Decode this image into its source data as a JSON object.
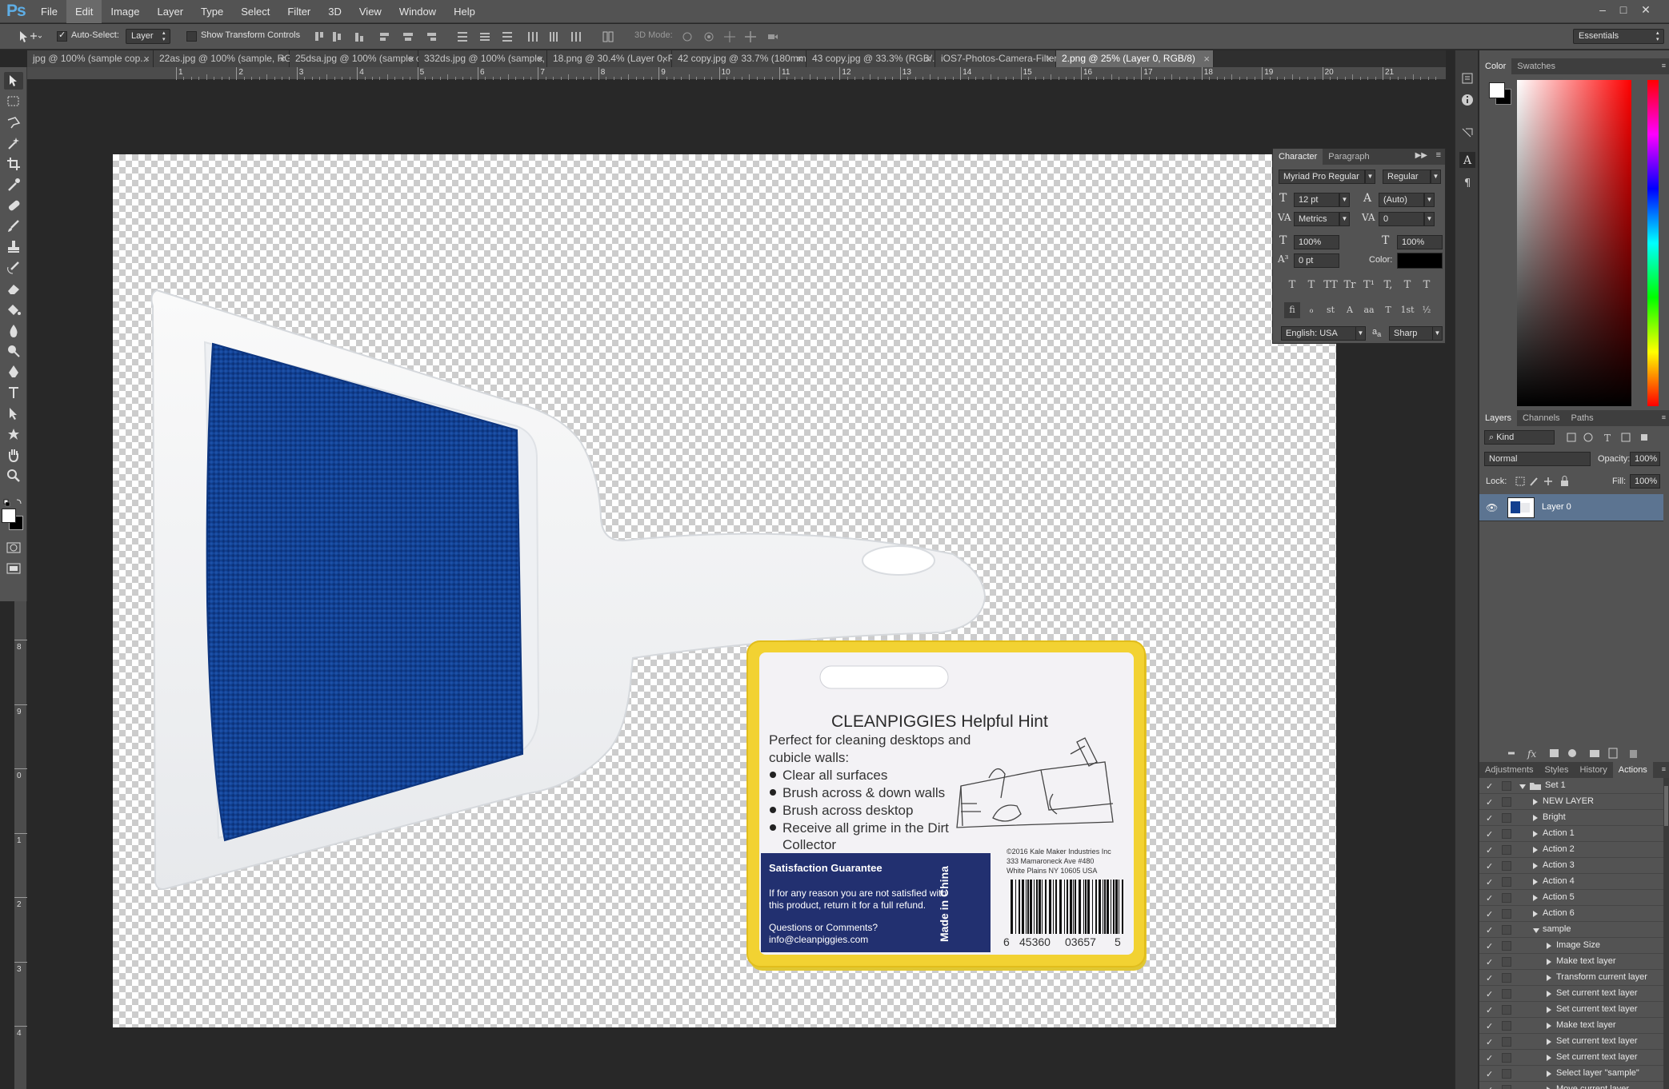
{
  "app": {
    "logo": "Ps"
  },
  "menu": [
    "File",
    "Edit",
    "Image",
    "Layer",
    "Type",
    "Select",
    "Filter",
    "3D",
    "View",
    "Window",
    "Help"
  ],
  "menu_active": "Edit",
  "options": {
    "auto_select_label": "Auto-Select:",
    "auto_select_value": "Layer",
    "show_transform_label": "Show Transform Controls",
    "mode_3d_label": "3D Mode:",
    "workspace": "Essentials"
  },
  "tabs": [
    {
      "label": "jpg @ 100% (sample cop...",
      "active": false
    },
    {
      "label": "22as.jpg @ 100% (sample, RG...",
      "active": false
    },
    {
      "label": "25dsa.jpg @ 100% (sample co...",
      "active": false
    },
    {
      "label": "332ds.jpg @ 100% (sample, R...",
      "active": false
    },
    {
      "label": "18.png @ 30.4% (Layer 0, RG...",
      "active": false
    },
    {
      "label": "42 copy.jpg @ 33.7% (180mm...",
      "active": false
    },
    {
      "label": "43 copy.jpg @ 33.3% (RGB/...",
      "active": false
    },
    {
      "label": "iOS7-Photos-Camera-Filters.png",
      "active": false
    },
    {
      "label": "2.png @ 25% (Layer 0, RGB/8)",
      "active": true
    }
  ],
  "tab_close": "×",
  "ruler_top": [
    "1",
    "2",
    "3",
    "4",
    "5",
    "6",
    "7",
    "8",
    "9",
    "10",
    "11",
    "12",
    "13",
    "14",
    "15",
    "16",
    "17",
    "18",
    "19",
    "20",
    "21"
  ],
  "ruler_left": [
    "8",
    "9",
    "0",
    "1",
    "2",
    "3",
    "4"
  ],
  "character": {
    "tabs": [
      "Character",
      "Paragraph"
    ],
    "font_family": "Myriad Pro Regular",
    "font_style": "Regular",
    "size": "12 pt",
    "leading": "(Auto)",
    "kerning": "Metrics",
    "tracking": "0",
    "vscale": "100%",
    "hscale": "100%",
    "baseline": "0 pt",
    "color_label": "Color:",
    "color_value": "#000000",
    "style_buttons": [
      "T",
      "T",
      "TT",
      "Tr",
      "T¹",
      "T,",
      "T",
      "T"
    ],
    "ot_buttons": [
      "fi",
      "ℴ",
      "st",
      "A",
      "aa",
      "T",
      "1st",
      "½"
    ],
    "language": "English: USA",
    "aa_label": "a",
    "aa_value": "Sharp"
  },
  "color_panel": {
    "tabs": [
      "Color",
      "Swatches"
    ],
    "fg": "#ffffff",
    "bg": "#000000"
  },
  "layers_panel": {
    "tabs": [
      "Layers",
      "Channels",
      "Paths"
    ],
    "filter": "Kind",
    "blend": "Normal",
    "opacity_label": "Opacity:",
    "opacity": "100%",
    "lock_label": "Lock:",
    "fill_label": "Fill:",
    "fill": "100%",
    "layer_name": "Layer 0"
  },
  "actions_panel": {
    "tabs": [
      "Adjustments",
      "Styles",
      "History",
      "Actions"
    ],
    "check": "✓",
    "rows": [
      {
        "label": "Set 1",
        "indent": 0,
        "open": true,
        "folder": true
      },
      {
        "label": "NEW LAYER",
        "indent": 1,
        "open": false
      },
      {
        "label": "Bright",
        "indent": 1,
        "open": false
      },
      {
        "label": "Action 1",
        "indent": 1,
        "open": false
      },
      {
        "label": "Action 2",
        "indent": 1,
        "open": false
      },
      {
        "label": "Action 3",
        "indent": 1,
        "open": false
      },
      {
        "label": "Action 4",
        "indent": 1,
        "open": false
      },
      {
        "label": "Action 5",
        "indent": 1,
        "open": false
      },
      {
        "label": "Action 6",
        "indent": 1,
        "open": false
      },
      {
        "label": "sample",
        "indent": 1,
        "open": true
      },
      {
        "label": "Image Size",
        "indent": 2,
        "open": false
      },
      {
        "label": "Make text layer",
        "indent": 2,
        "open": false
      },
      {
        "label": "Transform current layer",
        "indent": 2,
        "open": false
      },
      {
        "label": "Set current text layer",
        "indent": 2,
        "open": false
      },
      {
        "label": "Set current text layer",
        "indent": 2,
        "open": false
      },
      {
        "label": "Make text layer",
        "indent": 2,
        "open": false
      },
      {
        "label": "Set current text layer",
        "indent": 2,
        "open": false
      },
      {
        "label": "Set current text layer",
        "indent": 2,
        "open": false
      },
      {
        "label": "Select layer \"sample\"",
        "indent": 2,
        "open": false
      },
      {
        "label": "Move current layer",
        "indent": 2,
        "open": false
      }
    ]
  },
  "tag": {
    "brand": "CLEANPIGGIES",
    "brand_suffix": "Helpful Hint",
    "intro1": "Perfect for cleaning desktops and",
    "intro2": "cubicle walls:",
    "bullets": [
      "Clear all surfaces",
      "Brush across & down walls",
      "Brush across desktop",
      "Receive all grime in the Dirt"
    ],
    "bullet_cont": "Collector",
    "guarantee_title": "Satisfaction Guarantee",
    "guarantee_1": "If for any reason you are not satisfied with",
    "guarantee_2": "this product, return it for a full refund.",
    "questions": "Questions or Comments?",
    "email": "info@cleanpiggies.com",
    "made_in": "Made in China",
    "copyright1": "©2016 Kale Maker Industries Inc",
    "copyright2": "333 Mamaroneck Ave #480",
    "copyright3": "White Plains NY 10605 USA",
    "barcode_left": "6",
    "barcode_mid1": "45360",
    "barcode_mid2": "03657",
    "barcode_right": "5"
  }
}
